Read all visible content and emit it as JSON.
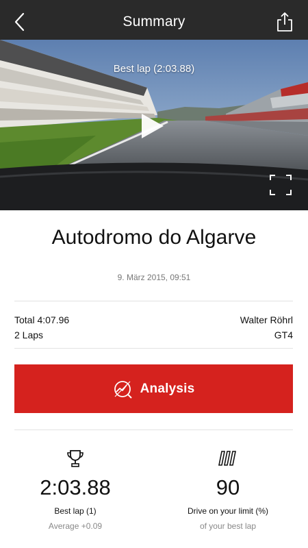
{
  "header": {
    "title": "Summary",
    "back_icon": "chevron-left-icon",
    "share_icon": "share-icon"
  },
  "video": {
    "caption": "Best lap (2:03.88)",
    "play_icon": "play-icon",
    "fullscreen_icon": "fullscreen-icon"
  },
  "session": {
    "track_name": "Autodromo do Algarve",
    "date": "9. März 2015, 09:51",
    "total": "Total 4:07.96",
    "laps": "2 Laps",
    "driver": "Walter Röhrl",
    "car": "GT4"
  },
  "analysis_button": {
    "label": "Analysis",
    "icon": "analysis-chart-icon",
    "color": "#d5221e"
  },
  "stats": {
    "best_lap": {
      "icon": "trophy-icon",
      "value": "2:03.88",
      "label": "Best lap (1)",
      "sub": "Average +0.09"
    },
    "drive_limit": {
      "icon": "speed-bars-icon",
      "value": "90",
      "label": "Drive on your limit (%)",
      "sub": "of your best lap"
    }
  },
  "colors": {
    "header_bg": "#2a2a2a",
    "accent": "#d5221e"
  }
}
